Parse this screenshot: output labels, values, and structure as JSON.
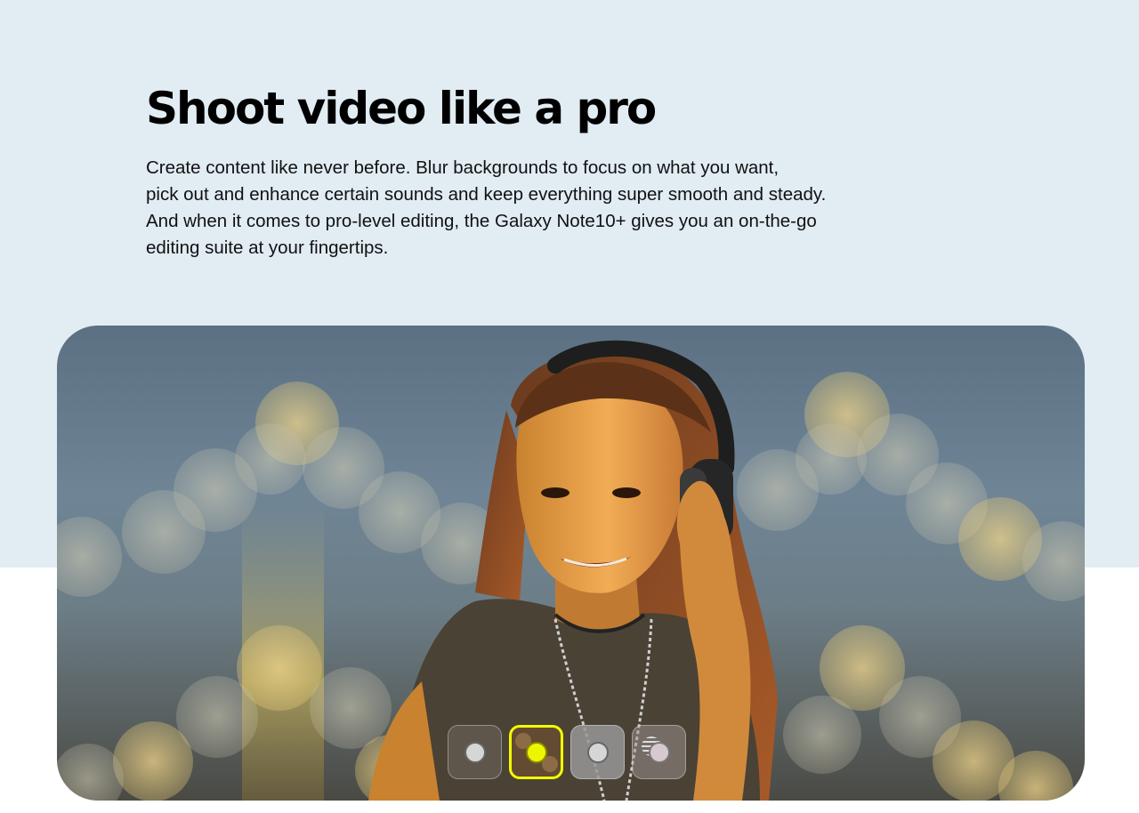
{
  "hero": {
    "headline": "Shoot video like a pro",
    "body_lines": [
      "Create content like never before. Blur backgrounds to focus on what you want,",
      "pick out and enhance certain sounds and keep everything super smooth and steady.",
      "And when it comes to pro-level editing, the Galaxy Note10+ gives you an on-the-go",
      "editing suite at your fingertips."
    ]
  },
  "video": {
    "subject_icon": "person-with-headphones-icon",
    "effects": [
      {
        "name": "blur-effect",
        "selected": false
      },
      {
        "name": "big-circle-effect",
        "selected": true
      },
      {
        "name": "color-point-effect",
        "selected": false
      },
      {
        "name": "glitch-effect",
        "selected": false
      }
    ]
  },
  "colors": {
    "band": "#e1ecf3",
    "selected_accent": "#f4ff00"
  }
}
